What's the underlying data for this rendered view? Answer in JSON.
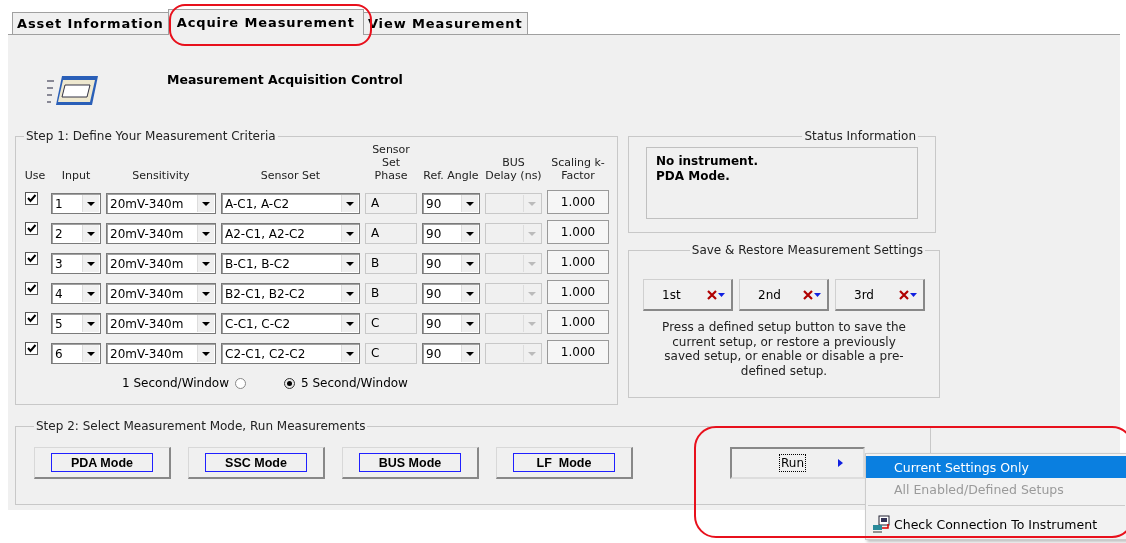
{
  "tabs": [
    {
      "label": "Asset Information",
      "selected": false
    },
    {
      "label": "Acquire Measurement",
      "selected": true
    },
    {
      "label": "View Measurement",
      "selected": false
    }
  ],
  "header": {
    "title": "Measurement Acquisition Control"
  },
  "step1": {
    "legend": "Step 1:  Define Your Measurement Criteria",
    "columns": [
      "Use",
      "Input",
      "Sensitivity",
      "Sensor Set",
      "Sensor Set Phase",
      "Ref. Angle",
      "BUS Delay (ns)",
      "Scaling k-Factor"
    ],
    "rows": [
      {
        "use": true,
        "input": "1",
        "sensitivity": "20mV-340m",
        "sensor_set": "A-C1, A-C2",
        "phase": "A",
        "ref_angle": "90",
        "k_factor": "1.000"
      },
      {
        "use": true,
        "input": "2",
        "sensitivity": "20mV-340m",
        "sensor_set": "A2-C1, A2-C2",
        "phase": "A",
        "ref_angle": "90",
        "k_factor": "1.000"
      },
      {
        "use": true,
        "input": "3",
        "sensitivity": "20mV-340m",
        "sensor_set": "B-C1, B-C2",
        "phase": "B",
        "ref_angle": "90",
        "k_factor": "1.000"
      },
      {
        "use": true,
        "input": "4",
        "sensitivity": "20mV-340m",
        "sensor_set": "B2-C1, B2-C2",
        "phase": "B",
        "ref_angle": "90",
        "k_factor": "1.000"
      },
      {
        "use": true,
        "input": "5",
        "sensitivity": "20mV-340m",
        "sensor_set": "C-C1, C-C2",
        "phase": "C",
        "ref_angle": "90",
        "k_factor": "1.000"
      },
      {
        "use": true,
        "input": "6",
        "sensitivity": "20mV-340m",
        "sensor_set": "C2-C1, C2-C2",
        "phase": "C",
        "ref_angle": "90",
        "k_factor": "1.000"
      }
    ],
    "window_options": [
      {
        "label": "1 Second/Window",
        "selected": false,
        "kind": "label-first"
      },
      {
        "label": "5 Second/Window",
        "selected": true,
        "kind": "radio-first"
      }
    ]
  },
  "status": {
    "legend": "Status Information",
    "lines": [
      "No instrument.",
      "PDA Mode."
    ]
  },
  "save_restore": {
    "legend": "Save & Restore Measurement Settings",
    "buttons": [
      "1st",
      "2nd",
      "3rd"
    ],
    "note": "Press a defined setup button to save the current setup, or restore a previously saved setup, or enable or disable a pre-defined setup."
  },
  "step2": {
    "legend": "Step 2:  Select Measurement Mode, Run Measurements",
    "mode_buttons": [
      "PDA Mode",
      "SSC Mode",
      "BUS Mode",
      "LF  Mode"
    ],
    "run_button": "Run"
  },
  "run_menu": [
    {
      "label": "Current Settings Only",
      "selected": true,
      "disabled": false,
      "kind": "option"
    },
    {
      "label": "All Enabled/Defined Setups",
      "selected": false,
      "disabled": true,
      "kind": "option"
    },
    {
      "label": "Check Connection To Instrument",
      "selected": false,
      "disabled": false,
      "kind": "action"
    }
  ]
}
